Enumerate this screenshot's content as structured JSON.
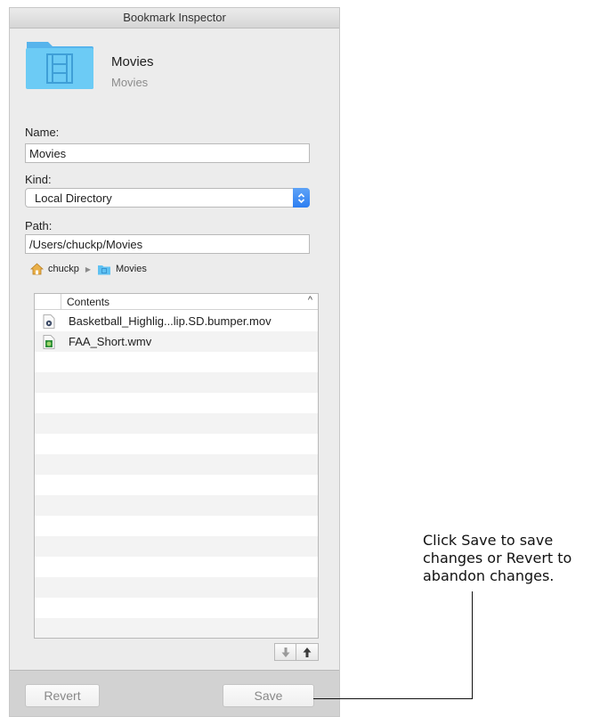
{
  "window": {
    "title": "Bookmark Inspector"
  },
  "header": {
    "name": "Movies",
    "kind": "Movies",
    "icon": "folder-movies-icon",
    "accent": "#5fc3f1"
  },
  "form": {
    "name_label": "Name:",
    "name_value": "Movies",
    "kind_label": "Kind:",
    "kind_value": "Local Directory",
    "path_label": "Path:",
    "path_value": "/Users/chuckp/Movies"
  },
  "pathbar": [
    {
      "label": "chuckp",
      "icon": "home-icon"
    },
    {
      "label": "Movies",
      "icon": "folder-icon"
    }
  ],
  "contents": {
    "column": "Contents",
    "sort_glyph": "^",
    "files": [
      {
        "name": "Basketball_Highlig...lip.SD.bumper.mov",
        "icon": "movie-file-icon"
      },
      {
        "name": "FAA_Short.wmv",
        "icon": "media-file-icon"
      }
    ]
  },
  "buttons": {
    "revert": "Revert",
    "save": "Save"
  },
  "callout": {
    "line1": "Click Save to save",
    "line2": "changes or Revert to",
    "line3": "abandon changes."
  }
}
